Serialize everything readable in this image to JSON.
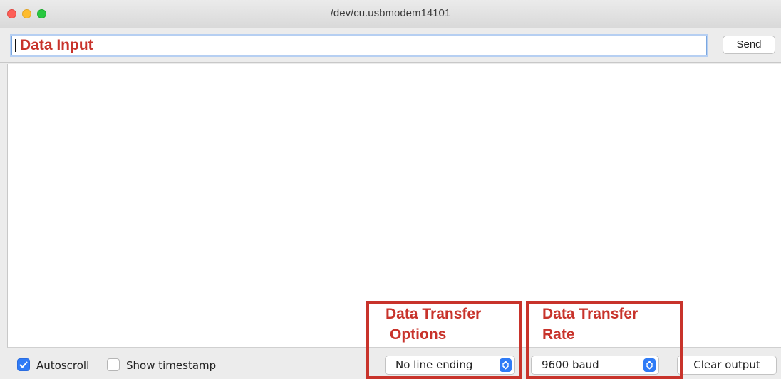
{
  "window": {
    "title": "/dev/cu.usbmodem14101"
  },
  "input": {
    "annotation": "Data Input",
    "value": ""
  },
  "toolbar": {
    "send_label": "Send"
  },
  "bottom": {
    "autoscroll_label": "Autoscroll",
    "autoscroll_checked": true,
    "timestamp_label": "Show timestamp",
    "timestamp_checked": false,
    "line_ending_selected": "No line ending",
    "baud_selected": "9600 baud",
    "clear_label": "Clear output"
  },
  "annotations": {
    "options_line1": "Data Transfer",
    "options_line2": "Options",
    "rate_line1": "Data Transfer",
    "rate_line2": "Rate"
  },
  "colors": {
    "annotation": "#c8332b",
    "accent": "#2f7bf6"
  }
}
